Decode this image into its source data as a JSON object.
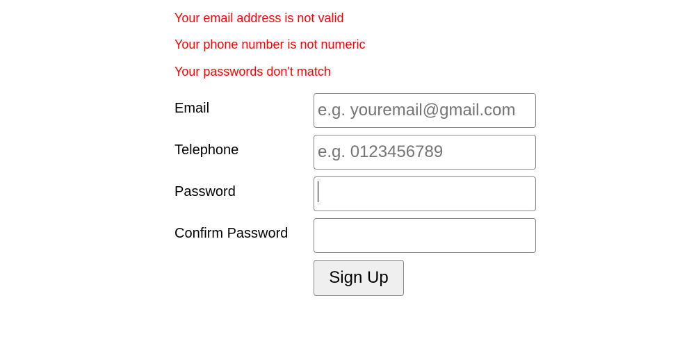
{
  "errors": [
    "Your email address is not valid",
    "Your phone number is not numeric",
    "Your passwords don't match"
  ],
  "form": {
    "email": {
      "label": "Email",
      "placeholder": "e.g. youremail@gmail.com",
      "value": ""
    },
    "telephone": {
      "label": "Telephone",
      "placeholder": "e.g. 0123456789",
      "value": ""
    },
    "password": {
      "label": "Password",
      "value": ""
    },
    "confirm_password": {
      "label": "Confirm Password",
      "value": ""
    },
    "submit_label": "Sign Up"
  },
  "colors": {
    "error": "#ff0000"
  }
}
